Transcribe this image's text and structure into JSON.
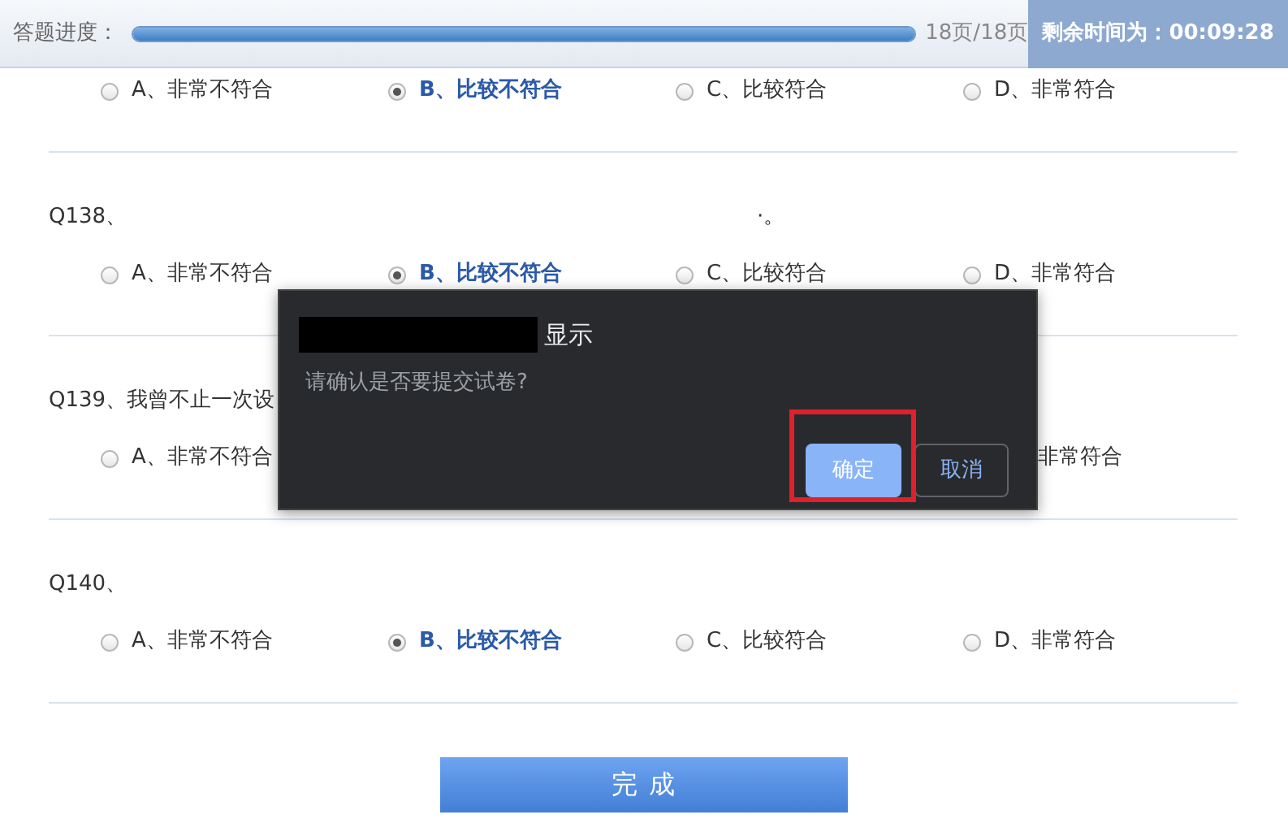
{
  "header": {
    "progress_label": "答题进度：",
    "progress": {
      "level": 1
    },
    "page_count": "18页/18页",
    "timer": "剩余时间为：00:09:28"
  },
  "questions": [
    {
      "options": [
        {
          "kind": "radio",
          "label": "A、非常不符合",
          "selected": false
        },
        {
          "kind": "radio",
          "label": "B、比较不符合",
          "selected": true
        },
        {
          "kind": "radio",
          "label": "C、比较符合",
          "selected": false
        },
        {
          "kind": "radio",
          "label": "D、非常符合",
          "selected": false
        }
      ]
    },
    {
      "title": "Q138、",
      "fragment": "·。",
      "options": [
        {
          "kind": "radio",
          "label": "A、非常不符合",
          "selected": false
        },
        {
          "kind": "radio",
          "label": "B、比较不符合",
          "selected": true
        },
        {
          "kind": "radio",
          "label": "C、比较符合",
          "selected": false
        },
        {
          "kind": "radio",
          "label": "D、非常符合",
          "selected": false
        }
      ]
    },
    {
      "title": "Q139、我曾不止一次设",
      "options": [
        {
          "kind": "radio",
          "label": "A、非常不符合",
          "selected": false
        },
        {
          "kind": "hidden"
        },
        {
          "kind": "hidden"
        },
        {
          "kind": "cut",
          "label": "非常符合"
        }
      ]
    },
    {
      "title": "Q140、",
      "options": [
        {
          "kind": "radio",
          "label": "A、非常不符合",
          "selected": false
        },
        {
          "kind": "radio",
          "label": "B、比较不符合",
          "selected": true
        },
        {
          "kind": "radio",
          "label": "C、比较符合",
          "selected": false
        },
        {
          "kind": "radio",
          "label": "D、非常符合",
          "selected": false
        }
      ]
    }
  ],
  "finish_button": "完 成",
  "dialog": {
    "title": "显示",
    "message": "请确认是否要提交试卷?",
    "buttons": [
      {
        "label": "确定",
        "primary": true,
        "highlighted": true
      },
      {
        "label": "取消",
        "primary": false,
        "highlighted": false
      }
    ]
  }
}
